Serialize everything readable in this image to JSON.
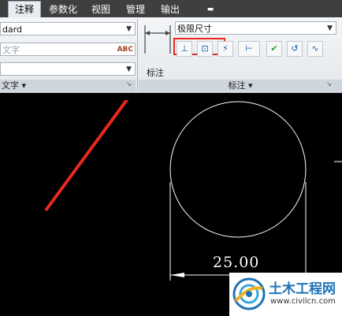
{
  "tabs": [
    {
      "label": "注释",
      "active": true
    },
    {
      "label": "参数化",
      "active": false
    },
    {
      "label": "视图",
      "active": false
    },
    {
      "label": "管理",
      "active": false
    },
    {
      "label": "输出",
      "active": false
    },
    {
      "label": "▬",
      "active": false
    }
  ],
  "text_panel": {
    "style_value": "dard",
    "text_placeholder": "文字",
    "abc_badge": "ABC",
    "blank_value": "",
    "panel_label": "文字 ▾"
  },
  "dim_panel": {
    "tool_label": "标注",
    "dimstyle_value": "极限尺寸",
    "panel_label": "标注 ▾",
    "button_icons": [
      "dim-continue-icon",
      "dim-break-icon",
      "dim-space-icon",
      "dim-baseline-icon",
      "dim-inspect-icon",
      "dim-update-icon",
      "dim-jog-icon"
    ],
    "button_glyphs": [
      "⊥",
      "⊡",
      "⚡",
      "⊢",
      "✔",
      "↺",
      "∿"
    ]
  },
  "drawing": {
    "dimension_text": "25.00"
  },
  "watermark": {
    "name": "土木工程网",
    "url": "www.civilcn.com"
  },
  "colors": {
    "ribbon": "#e9ecef",
    "tab_bar": "#3f3f3f",
    "canvas": "#000000",
    "highlight": "#e8281e",
    "arrow": "#e8281e",
    "watermark_brand": "#1e73b8"
  }
}
